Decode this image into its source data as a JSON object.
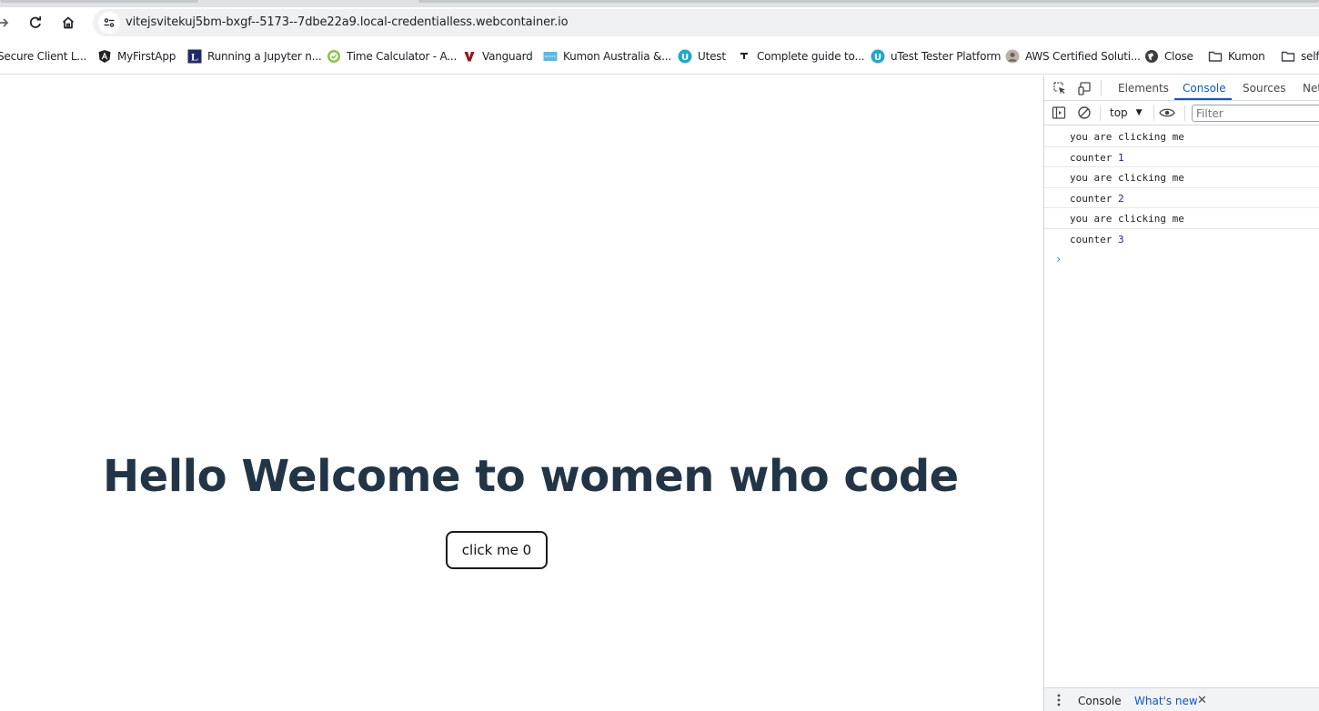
{
  "browser": {
    "url": "vitejsvitekuj5bm-bxgf--5173--7dbe22a9.local-credentialless.webcontainer.io",
    "icons": {
      "forward": "forward-arrow-icon",
      "reload": "reload-icon",
      "home": "home-icon",
      "site_info": "site-info-icon"
    }
  },
  "bookmarks": [
    {
      "label": "Secure Client L...",
      "icon": "bookmark-favicon-icon"
    },
    {
      "label": "MyFirstApp",
      "icon": "angular-icon"
    },
    {
      "label": "Running a Jupyter n...",
      "icon": "letter-l-icon"
    },
    {
      "label": "Time Calculator - A...",
      "icon": "check-circle-icon"
    },
    {
      "label": "Vanguard",
      "icon": "vanguard-icon"
    },
    {
      "label": "Kumon Australia &...",
      "icon": "kumon-icon"
    },
    {
      "label": "Utest",
      "icon": "utest-icon"
    },
    {
      "label": "Complete guide to...",
      "icon": "medium-icon"
    },
    {
      "label": "uTest Tester Platform",
      "icon": "utest-icon"
    },
    {
      "label": "AWS Certified Soluti...",
      "icon": "avatar-icon"
    },
    {
      "label": "Close",
      "icon": "globe-icon"
    },
    {
      "label": "Kumon",
      "icon": "folder-icon"
    },
    {
      "label": "self",
      "icon": "folder-icon"
    }
  ],
  "page": {
    "title": "Hello Welcome to women who code",
    "button_label": "click me 0"
  },
  "devtools": {
    "tabs": [
      "Elements",
      "Console",
      "Sources",
      "Net"
    ],
    "active_tab": "Console",
    "context": "top",
    "filter_placeholder": "Filter",
    "logs": [
      {
        "text": "you are clicking me",
        "value": ""
      },
      {
        "text": "counter ",
        "value": "1"
      },
      {
        "text": "you are clicking me",
        "value": ""
      },
      {
        "text": "counter ",
        "value": "2"
      },
      {
        "text": "you are clicking me",
        "value": ""
      },
      {
        "text": "counter ",
        "value": "3"
      }
    ],
    "drawer_tabs": [
      "Console",
      "What's new"
    ]
  },
  "colors": {
    "heading": "#213547",
    "active_tab": "#0b57d0",
    "log_number": "#1a1aa6"
  }
}
